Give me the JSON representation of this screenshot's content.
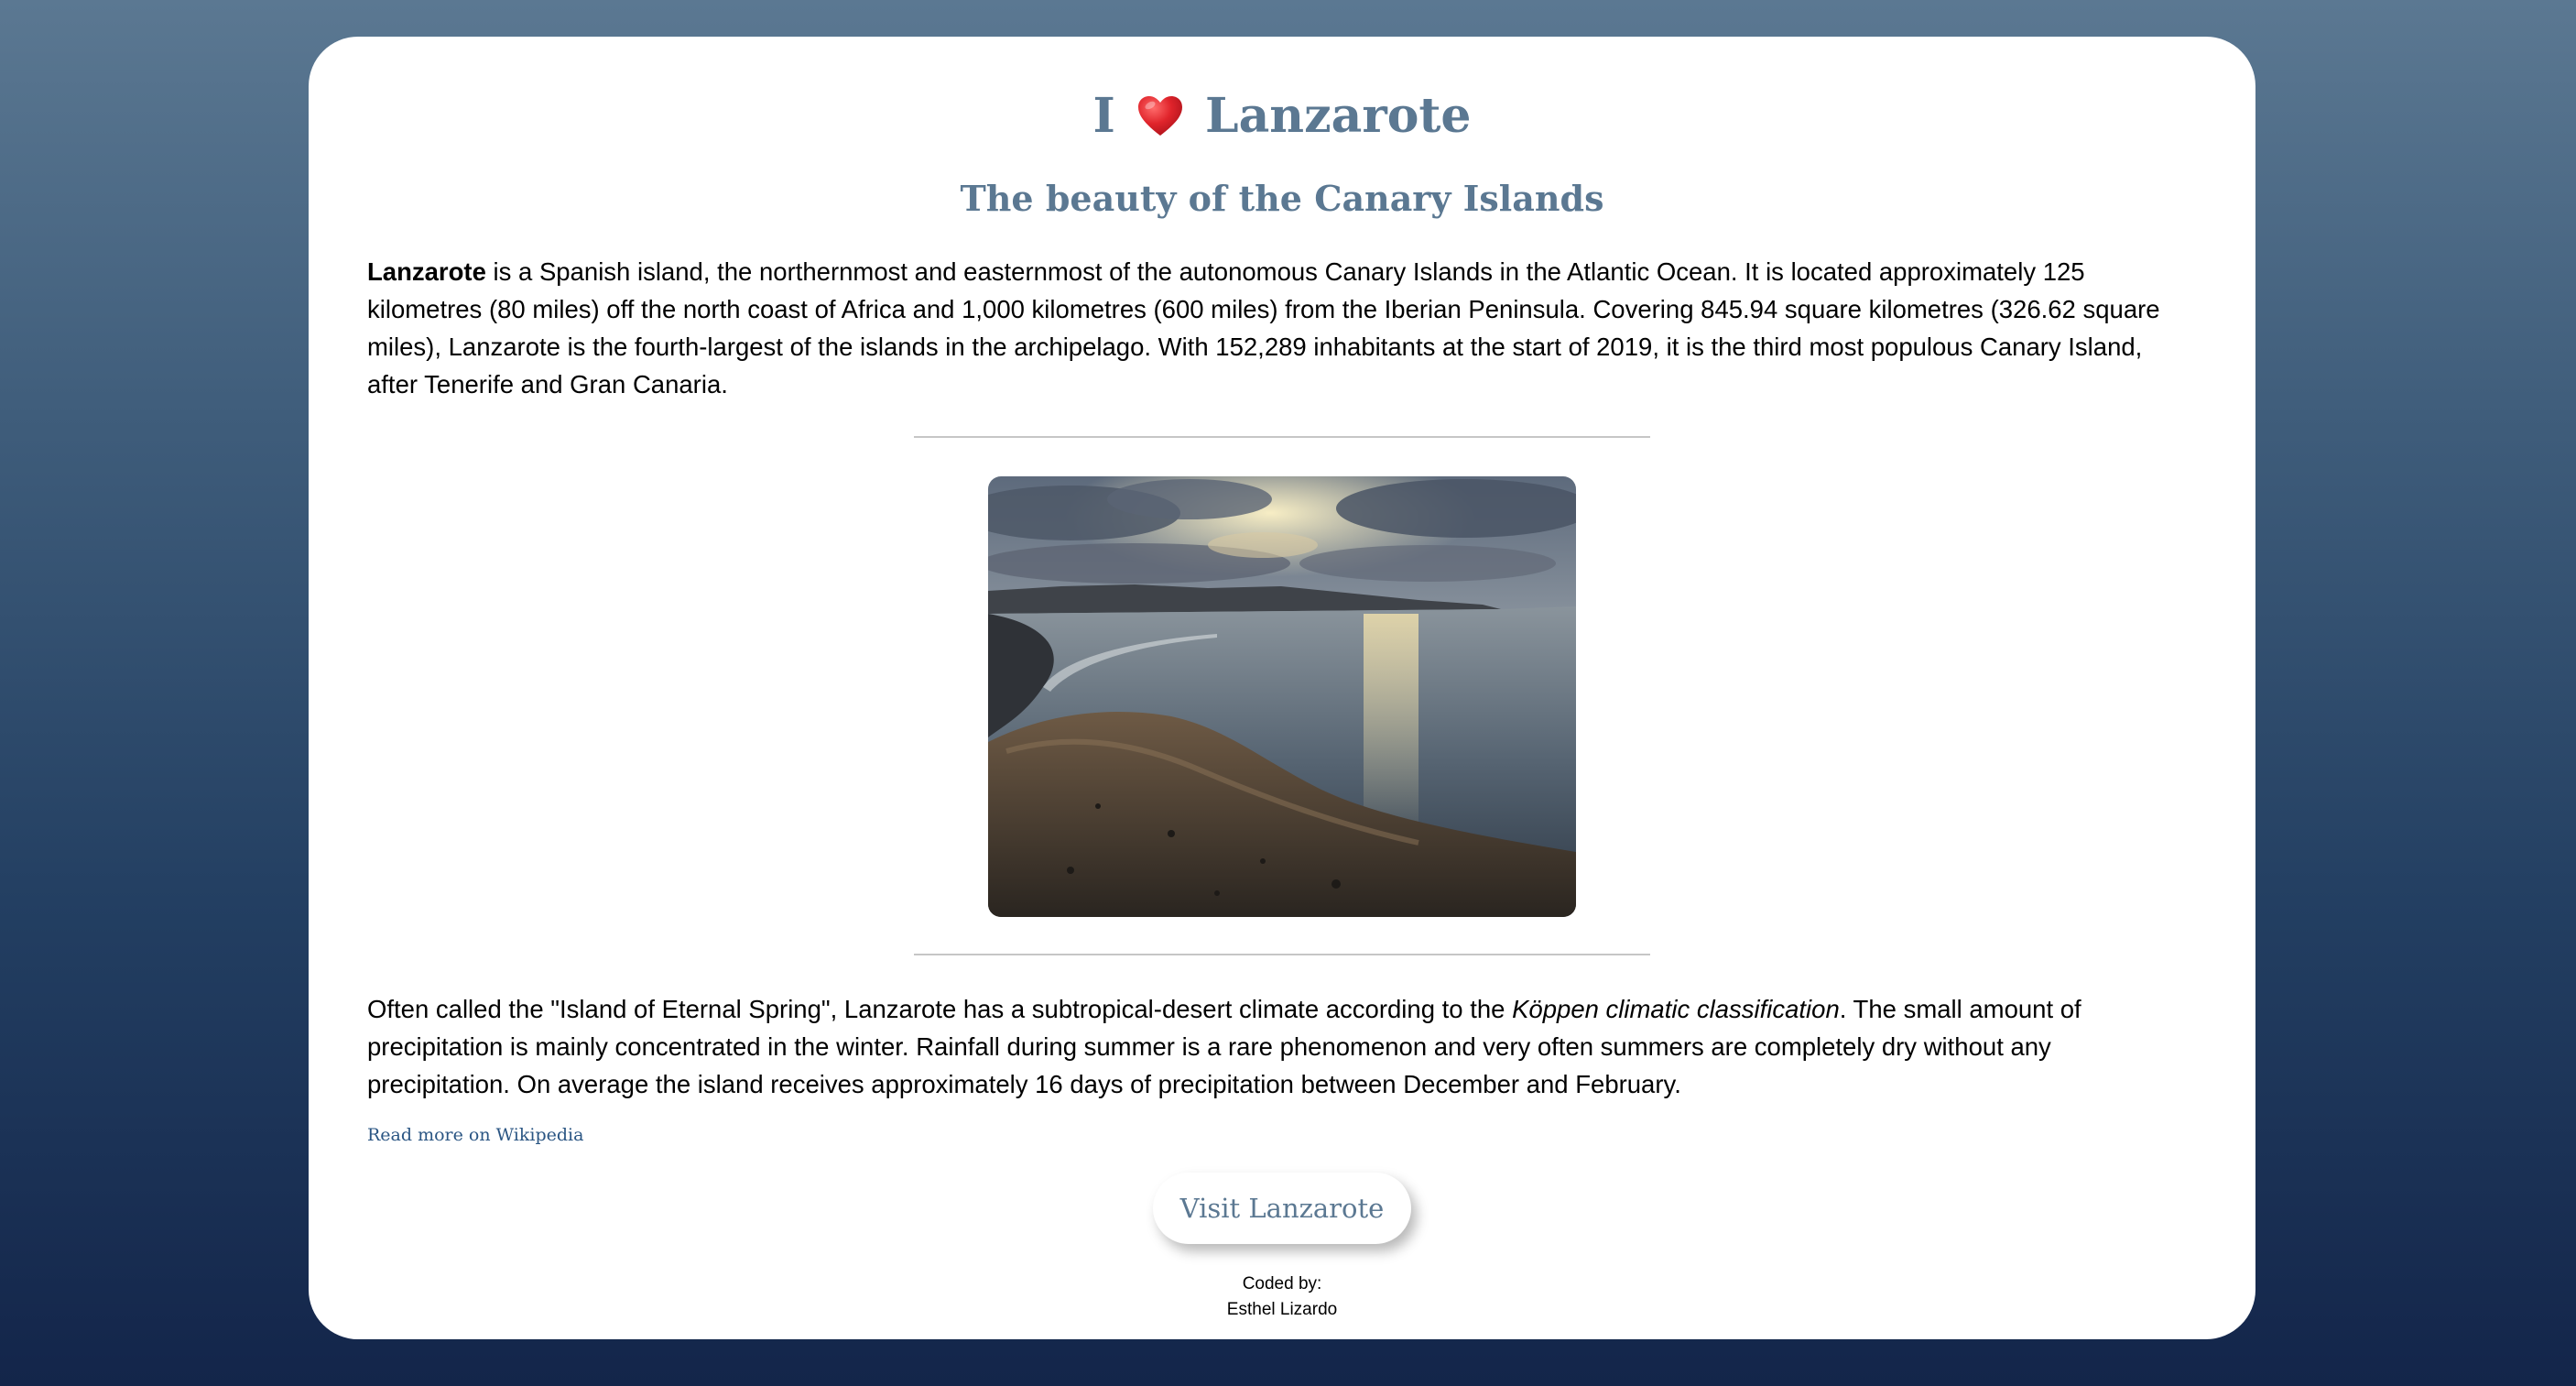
{
  "header": {
    "title_prefix": "I",
    "title_suffix": "Lanzarote",
    "subtitle": "The beauty of the Canary Islands"
  },
  "intro": {
    "bold_lead": "Lanzarote",
    "text": " is a Spanish island, the northernmost and easternmost of the autonomous Canary Islands in the Atlantic Ocean. It is located approximately 125 kilometres (80 miles) off the north coast of Africa and 1,000 kilometres (600 miles) from the Iberian Peninsula. Covering 845.94 square kilometres (326.62 square miles), Lanzarote is the fourth-largest of the islands in the archipelago. With 152,289 inhabitants at the start of 2019, it is the third most populous Canary Island, after Tenerife and Gran Canaria."
  },
  "climate": {
    "text_before": "Often called the \"Island of Eternal Spring\", Lanzarote has a subtropical-desert climate according to the ",
    "italic": "Köppen climatic classification",
    "text_after": ". The small amount of precipitation is mainly concentrated in the winter. Rainfall during summer is a rare phenomenon and very often summers are completely dry without any precipitation. On average the island receives approximately 16 days of precipitation between December and February."
  },
  "links": {
    "wikipedia": "Read more on Wikipedia"
  },
  "cta": {
    "visit_label": "Visit Lanzarote"
  },
  "footer": {
    "coded_by_label": "Coded by:",
    "author": "Esthel Lizardo"
  },
  "colors": {
    "heading": "#5b7892",
    "link": "#2a5583",
    "heart": "#e0242b"
  },
  "icons": {
    "heart": "heart-icon"
  }
}
